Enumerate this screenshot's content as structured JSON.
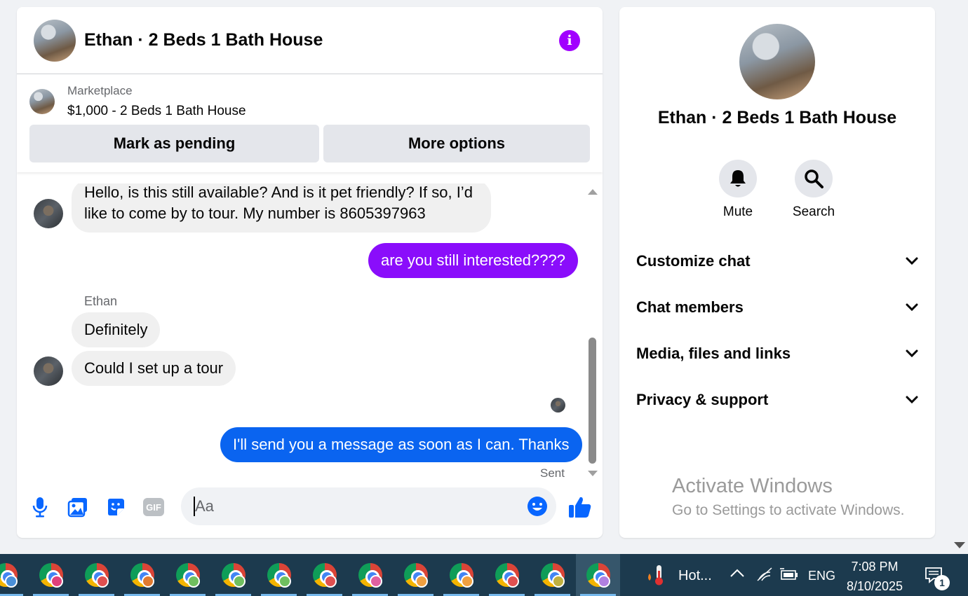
{
  "chat": {
    "title": "Ethan · 2 Beds 1 Bath House",
    "listing": {
      "kind": "Marketplace",
      "name": "$1,000 - 2 Beds 1 Bath House",
      "mark_pending_label": "Mark as pending",
      "more_options_label": "More options"
    },
    "messages": [
      {
        "direction": "in",
        "text": "Hello, is this still available? And is it pet friendly? If so, I’d like to come by to tour. My number is 8605397963"
      },
      {
        "direction": "out",
        "text": "are you still interested????"
      },
      {
        "direction": "in",
        "sender": "Ethan",
        "text": "Definitely"
      },
      {
        "direction": "in",
        "text": "Could I set up a tour"
      },
      {
        "direction": "out",
        "text": "I'll send you a message as soon as I can. Thanks"
      }
    ],
    "sender_name": "Ethan",
    "sent_status": "Sent",
    "composer": {
      "placeholder": "Aa",
      "gif_label": "GIF"
    }
  },
  "side": {
    "title": "Ethan · 2 Beds 1 Bath House",
    "mute_label": "Mute",
    "search_label": "Search",
    "sections": [
      "Customize chat",
      "Chat members",
      "Media, files and links",
      "Privacy & support"
    ]
  },
  "watermark": {
    "line1": "Activate Windows",
    "line2": "Go to Settings to activate Windows."
  },
  "taskbar": {
    "weather_label": "Hot...",
    "language": "ENG",
    "time": "7:08 PM",
    "date": "8/10/2025",
    "notification_count": "1",
    "profile_colors": [
      "#4a90d9",
      "#e0407a",
      "#e05050",
      "#e07a30",
      "#6fbf5f",
      "#6fbf5f",
      "#6fbf5f",
      "#e05050",
      "#e060a0",
      "#f0a040",
      "#f0a040",
      "#e05050",
      "#c0b040",
      "#b080e0"
    ]
  },
  "colors": {
    "accent_purple": "#8a0dfb",
    "accent_blue": "#0a64f0",
    "icon_blue": "#0866ff"
  }
}
